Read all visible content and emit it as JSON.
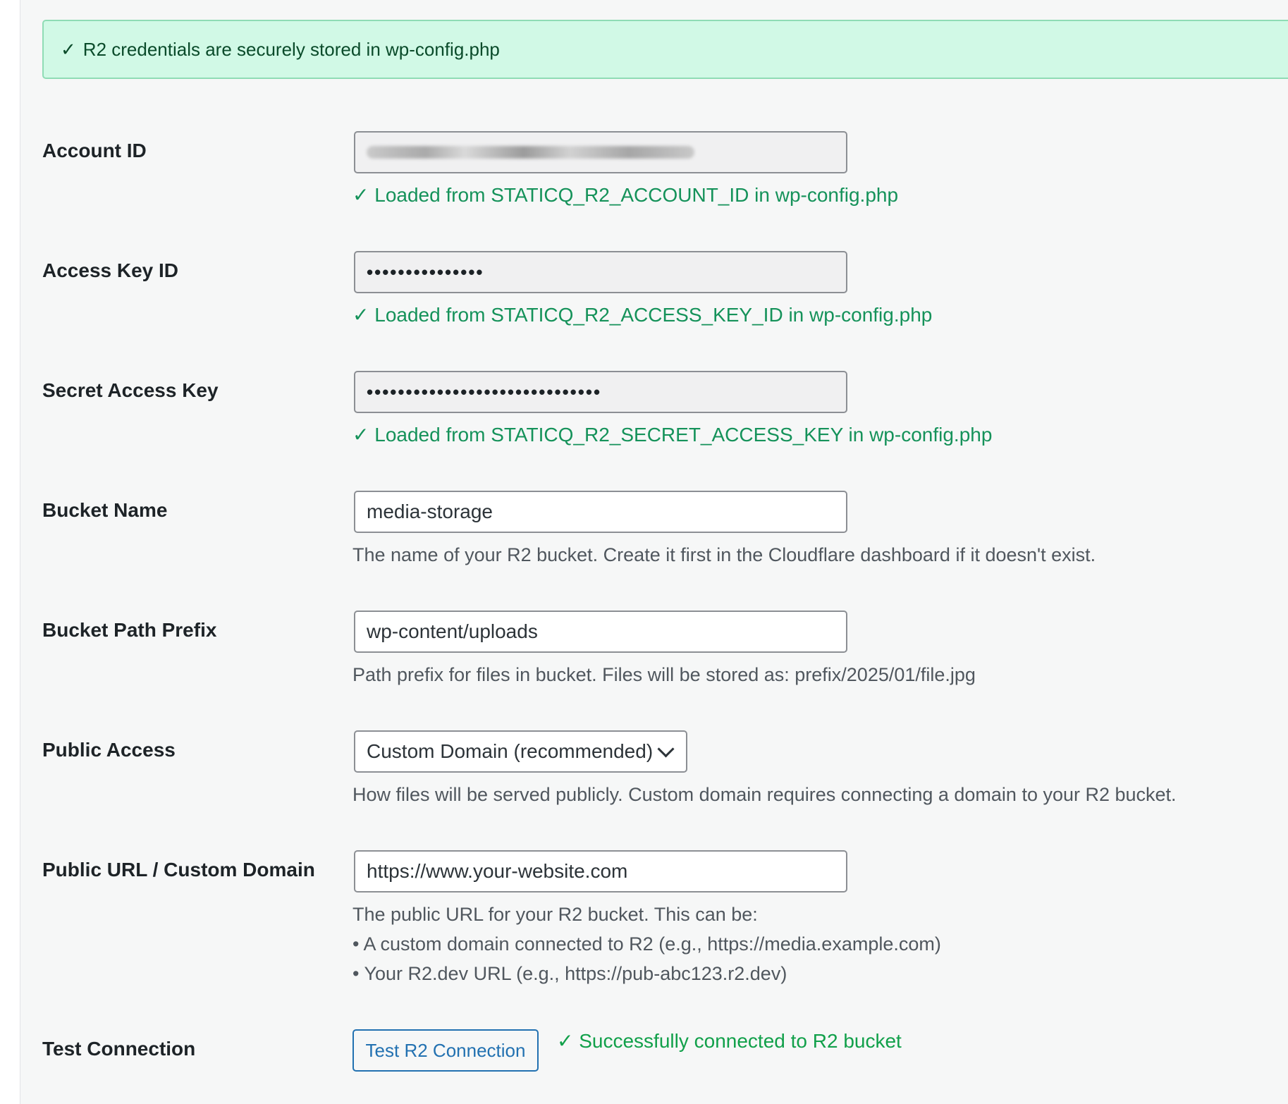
{
  "notice": {
    "check": "✓",
    "text": "R2 credentials are securely stored in wp-config.php"
  },
  "account_id": {
    "label": "Account ID",
    "hint": "✓ Loaded from STATICQ_R2_ACCOUNT_ID in wp-config.php"
  },
  "access_key_id": {
    "label": "Access Key ID",
    "value": "•••••••••••••••",
    "hint": "✓ Loaded from STATICQ_R2_ACCESS_KEY_ID in wp-config.php"
  },
  "secret_access_key": {
    "label": "Secret Access Key",
    "value": "••••••••••••••••••••••••••••••",
    "hint": "✓ Loaded from STATICQ_R2_SECRET_ACCESS_KEY in wp-config.php"
  },
  "bucket_name": {
    "label": "Bucket Name",
    "value": "media-storage",
    "hint": "The name of your R2 bucket. Create it first in the Cloudflare dashboard if it doesn't exist."
  },
  "bucket_path_prefix": {
    "label": "Bucket Path Prefix",
    "value": "wp-content/uploads",
    "hint": "Path prefix for files in bucket. Files will be stored as: prefix/2025/01/file.jpg"
  },
  "public_access": {
    "label": "Public Access",
    "selected": "Custom Domain (recommended)",
    "hint": "How files will be served publicly. Custom domain requires connecting a domain to your R2 bucket."
  },
  "public_url": {
    "label": "Public URL / Custom Domain",
    "value": "https://www.your-website.com",
    "hint_intro": "The public URL for your R2 bucket. This can be:",
    "hint_items": [
      "• A custom domain connected to R2 (e.g., https://media.example.com)",
      "• Your R2.dev URL (e.g., https://pub-abc123.r2.dev)"
    ]
  },
  "test_connection": {
    "label": "Test Connection",
    "button": "Test R2 Connection",
    "status": "✓ Successfully connected to R2 bucket"
  }
}
